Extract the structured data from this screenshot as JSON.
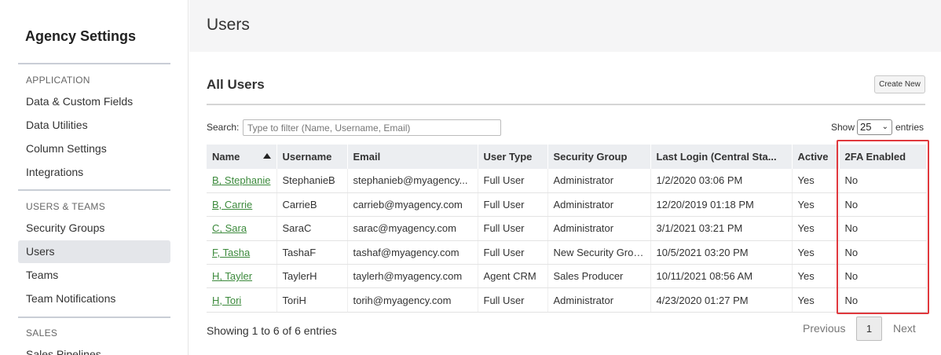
{
  "sidebar": {
    "title": "Agency Settings",
    "sections": [
      {
        "label": "APPLICATION"
      },
      {
        "label": "USERS & TEAMS"
      },
      {
        "label": "SALES"
      }
    ],
    "items": [
      {
        "label": "Data & Custom Fields"
      },
      {
        "label": "Data Utilities"
      },
      {
        "label": "Column Settings"
      },
      {
        "label": "Integrations"
      },
      {
        "label": "Security Groups"
      },
      {
        "label": "Users",
        "active": true
      },
      {
        "label": "Teams"
      },
      {
        "label": "Team Notifications"
      },
      {
        "label": "Sales Pipelines"
      }
    ]
  },
  "header": {
    "title": "Users"
  },
  "card": {
    "title": "All Users",
    "create_label": "Create New"
  },
  "filter": {
    "search_label": "Search:",
    "search_placeholder": "Type to filter (Name, Username, Email)",
    "search_value": "",
    "show_label": "Show",
    "page_size": "25",
    "entries_label": "entries"
  },
  "table": {
    "columns": [
      "Name",
      "Username",
      "Email",
      "User Type",
      "Security Group",
      "Last Login (Central Sta...",
      "Active",
      "2FA Enabled"
    ],
    "sort_column": "Name",
    "rows": [
      [
        "B, Stephanie",
        "StephanieB",
        "stephanieb@myagency...",
        "Full User",
        "Administrator",
        "1/2/2020 03:06 PM",
        "Yes",
        "No"
      ],
      [
        "B, Carrie",
        "CarrieB",
        "carrieb@myagency.com",
        "Full User",
        "Administrator",
        "12/20/2019 01:18 PM",
        "Yes",
        "No"
      ],
      [
        "C, Sara",
        "SaraC",
        "sarac@myagency.com",
        "Full User",
        "Administrator",
        "3/1/2021 03:21 PM",
        "Yes",
        "No"
      ],
      [
        "F, Tasha",
        "TashaF",
        "tashaf@myagency.com",
        "Full User",
        "New Security Group",
        "10/5/2021 03:20 PM",
        "Yes",
        "No"
      ],
      [
        "H, Tayler",
        "TaylerH",
        "taylerh@myagency.com",
        "Agent CRM",
        "Sales Producer",
        "10/11/2021 08:56 AM",
        "Yes",
        "No"
      ],
      [
        "H, Tori",
        "ToriH",
        "torih@myagency.com",
        "Full User",
        "Administrator",
        "4/23/2020 01:27 PM",
        "Yes",
        "No"
      ]
    ]
  },
  "footer": {
    "showing_text": "Showing 1 to 6 of 6 entries",
    "previous_label": "Previous",
    "current_page": "1",
    "next_label": "Next"
  },
  "colors": {
    "link": "#3c8a3c",
    "highlight": "#e0383d",
    "active_item": "#e4e6ea"
  }
}
